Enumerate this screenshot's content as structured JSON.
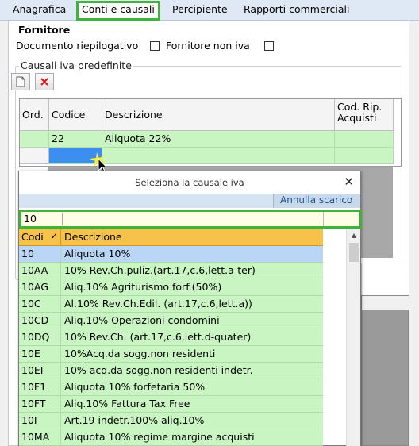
{
  "tabs": [
    {
      "label": "Anagrafica"
    },
    {
      "label": "Conti e causali"
    },
    {
      "label": "Percipiente"
    },
    {
      "label": "Rapporti commerciali"
    }
  ],
  "fornitore": {
    "title": "Fornitore",
    "documento_label": "Documento riepilogativo",
    "non_iva_label": "Fornitore non iva"
  },
  "causali_group": {
    "title": "Causali iva predefinite",
    "columns": [
      "Ord.",
      "Codice",
      "Descrizione",
      "Cod. Rip. Acquisti"
    ],
    "rows": [
      {
        "ord": "",
        "codice": "22",
        "descrizione": "Aliquota 22%",
        "cod_rip": ""
      }
    ]
  },
  "popup": {
    "title": "Seleziona la causale iva",
    "close": "✕",
    "annulla": "Annulla scarico",
    "filter_value": "10",
    "columns": [
      "Codi",
      "Descrizione"
    ],
    "sort_glyph": "✓",
    "rows": [
      {
        "codice": "10",
        "descrizione": "Aliquota 10%"
      },
      {
        "codice": "10AA",
        "descrizione": "10% Rev.Ch.puliz.(art.17,c.6,lett.a-ter)"
      },
      {
        "codice": "10AG",
        "descrizione": "Aliq.10% Agriturismo forf.(50%)"
      },
      {
        "codice": "10C",
        "descrizione": "Al.10% Rev.Ch.Edil. (art.17,c.6,lett.a))"
      },
      {
        "codice": "10CD",
        "descrizione": "Aliq.10% Operazioni condomini"
      },
      {
        "codice": "10DQ",
        "descrizione": "10% Rev.Ch. (art.17,c.6,lett.d-quater)"
      },
      {
        "codice": "10E",
        "descrizione": "10%Acq.da sogg.non residenti"
      },
      {
        "codice": "10EI",
        "descrizione": "10% acq.da sogg.non residenti indetr."
      },
      {
        "codice": "10F1",
        "descrizione": "Aliquota 10% forfetaria 50%"
      },
      {
        "codice": "10FT",
        "descrizione": "Aliq.10% Fattura Tax Free"
      },
      {
        "codice": "10I",
        "descrizione": "Art.19 indetr.100% aliq.10%"
      },
      {
        "codice": "10MA",
        "descrizione": "Aliquota 10% regime margine acquisti"
      }
    ]
  },
  "colors": {
    "highlight": "#3db33d",
    "row_bg": "#c9f5c2",
    "header_bg": "#f6c24a",
    "selected_row": "#b9d6f7"
  }
}
